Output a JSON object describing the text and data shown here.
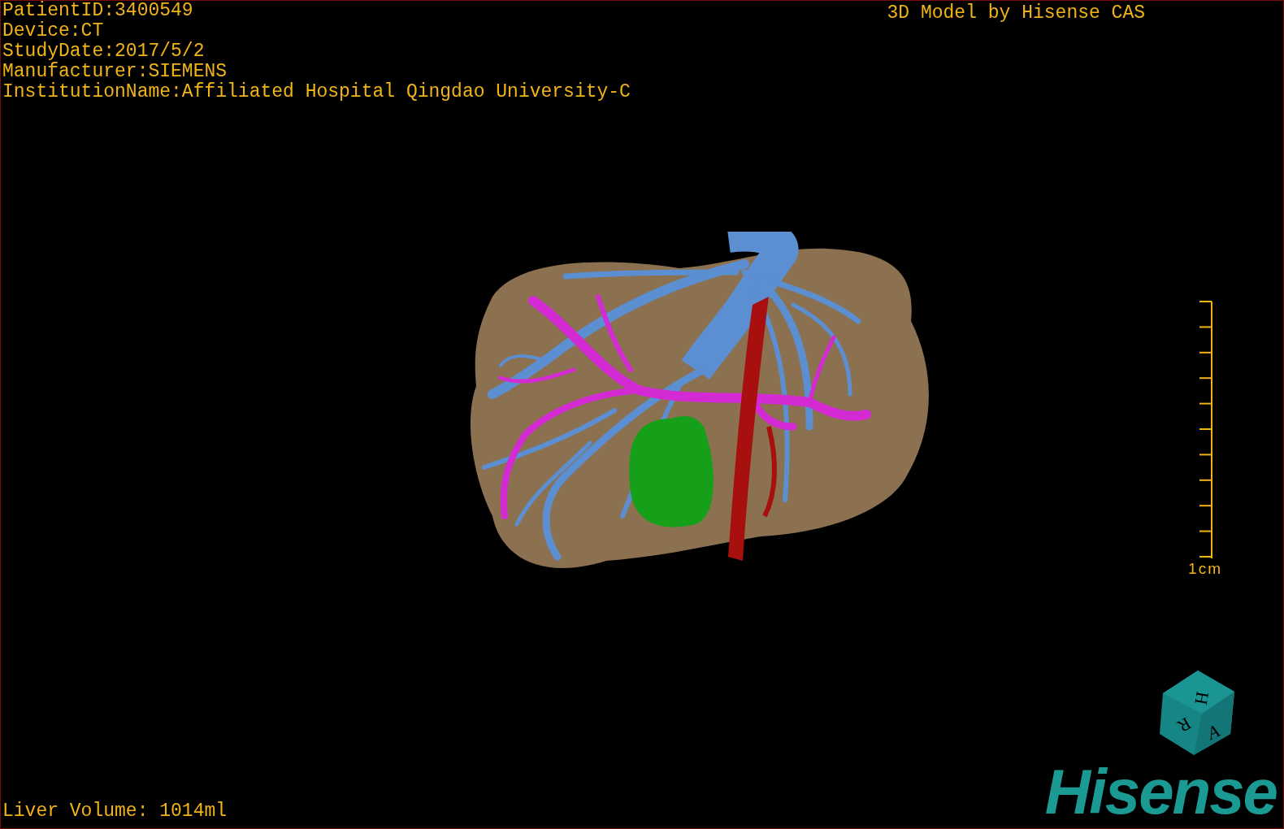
{
  "patient_info": [
    "PatientID:3400549",
    "Device:CT",
    "StudyDate:2017/5/2",
    "Manufacturer:SIEMENS",
    "InstitutionName:Affiliated Hospital Qingdao University-C"
  ],
  "title": "3D Model by Hisense CAS",
  "scale": {
    "label": "1cm"
  },
  "orientation_cube": {
    "faces": [
      "H",
      "R",
      "A"
    ]
  },
  "liver_volume": "Liver Volume: 1014ml",
  "logo": "Hisense"
}
